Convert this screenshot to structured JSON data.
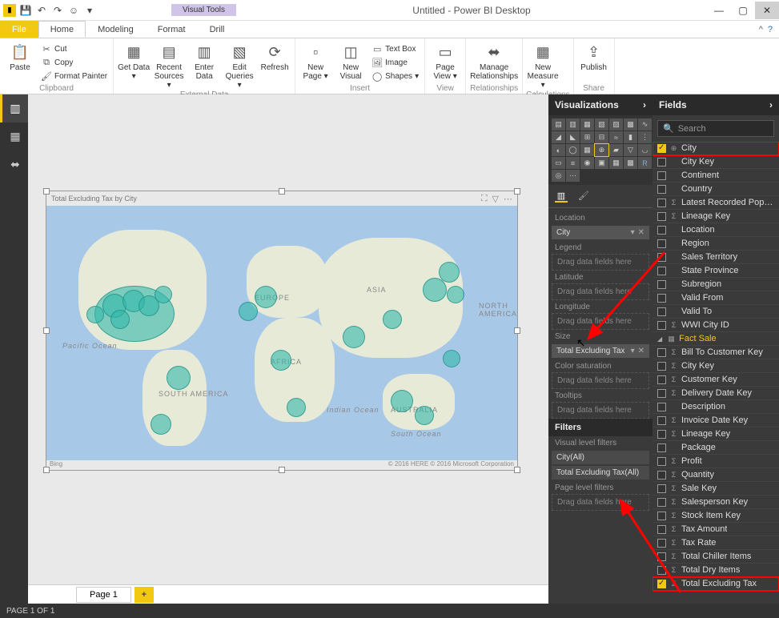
{
  "window": {
    "title": "Untitled - Power BI Desktop",
    "visual_tools": "Visual Tools"
  },
  "qat": {
    "save": "💾",
    "undo": "↶",
    "redo": "↷",
    "smile": "☺"
  },
  "tabs": {
    "file": "File",
    "home": "Home",
    "modeling": "Modeling",
    "format": "Format",
    "drill": "Drill"
  },
  "ribbon": {
    "clipboard": {
      "label": "Clipboard",
      "paste": "Paste",
      "cut": "Cut",
      "copy": "Copy",
      "format_painter": "Format Painter"
    },
    "external": {
      "label": "External Data",
      "get_data": "Get Data",
      "recent": "Recent Sources",
      "enter": "Enter Data",
      "edit": "Edit Queries",
      "refresh": "Refresh"
    },
    "insert": {
      "label": "Insert",
      "new_page": "New Page",
      "new_visual": "New Visual",
      "text_box": "Text Box",
      "image": "Image",
      "shapes": "Shapes"
    },
    "view": {
      "label": "View",
      "page_view": "Page View"
    },
    "relationships": {
      "label": "Relationships",
      "manage": "Manage Relationships"
    },
    "calc": {
      "label": "Calculations",
      "new_measure": "New Measure"
    },
    "share": {
      "label": "Share",
      "publish": "Publish"
    }
  },
  "visual": {
    "title": "Total Excluding Tax by City",
    "bing": "Bing",
    "copyright": "© 2016 HERE © 2016 Microsoft Corporation"
  },
  "map_labels": {
    "na": "NORTH AMERICA",
    "sa": "SOUTH AMERICA",
    "eu": "EUROPE",
    "af": "AFRICA",
    "as": "ASIA",
    "au": "AUSTRALIA",
    "po": "Pacific Ocean",
    "so": "South Ocean",
    "io": "Indian Ocean"
  },
  "pages": {
    "page1": "Page 1",
    "status": "PAGE 1 OF 1"
  },
  "viz_pane": {
    "title": "Visualizations",
    "wells": {
      "location": "Location",
      "location_val": "City",
      "legend": "Legend",
      "latitude": "Latitude",
      "longitude": "Longitude",
      "size": "Size",
      "size_val": "Total Excluding Tax",
      "color_sat": "Color saturation",
      "tooltips": "Tooltips",
      "drag": "Drag data fields here"
    },
    "filters": {
      "title": "Filters",
      "visual_level": "Visual level filters",
      "city": "City(All)",
      "tet": "Total Excluding Tax(All)",
      "page_level": "Page level filters"
    }
  },
  "fields_pane": {
    "title": "Fields",
    "search": "Search",
    "dim_city": [
      {
        "name": "City",
        "checked": true,
        "icon": "⊕",
        "hl": true
      },
      {
        "name": "City Key",
        "checked": false,
        "icon": ""
      },
      {
        "name": "Continent",
        "checked": false,
        "icon": ""
      },
      {
        "name": "Country",
        "checked": false,
        "icon": ""
      },
      {
        "name": "Latest Recorded Popu…",
        "checked": false,
        "icon": "Σ"
      },
      {
        "name": "Lineage Key",
        "checked": false,
        "icon": "Σ"
      },
      {
        "name": "Location",
        "checked": false,
        "icon": ""
      },
      {
        "name": "Region",
        "checked": false,
        "icon": ""
      },
      {
        "name": "Sales Territory",
        "checked": false,
        "icon": ""
      },
      {
        "name": "State Province",
        "checked": false,
        "icon": ""
      },
      {
        "name": "Subregion",
        "checked": false,
        "icon": ""
      },
      {
        "name": "Valid From",
        "checked": false,
        "icon": ""
      },
      {
        "name": "Valid To",
        "checked": false,
        "icon": ""
      },
      {
        "name": "WWI City ID",
        "checked": false,
        "icon": "Σ"
      }
    ],
    "fact_sale_label": "Fact Sale",
    "fact_sale": [
      {
        "name": "Bill To Customer Key",
        "checked": false,
        "icon": "Σ"
      },
      {
        "name": "City Key",
        "checked": false,
        "icon": "Σ"
      },
      {
        "name": "Customer Key",
        "checked": false,
        "icon": "Σ"
      },
      {
        "name": "Delivery Date Key",
        "checked": false,
        "icon": "Σ"
      },
      {
        "name": "Description",
        "checked": false,
        "icon": ""
      },
      {
        "name": "Invoice Date Key",
        "checked": false,
        "icon": "Σ"
      },
      {
        "name": "Lineage Key",
        "checked": false,
        "icon": "Σ"
      },
      {
        "name": "Package",
        "checked": false,
        "icon": ""
      },
      {
        "name": "Profit",
        "checked": false,
        "icon": "Σ"
      },
      {
        "name": "Quantity",
        "checked": false,
        "icon": "Σ"
      },
      {
        "name": "Sale Key",
        "checked": false,
        "icon": "Σ"
      },
      {
        "name": "Salesperson Key",
        "checked": false,
        "icon": "Σ"
      },
      {
        "name": "Stock Item Key",
        "checked": false,
        "icon": "Σ"
      },
      {
        "name": "Tax Amount",
        "checked": false,
        "icon": "Σ"
      },
      {
        "name": "Tax Rate",
        "checked": false,
        "icon": "Σ"
      },
      {
        "name": "Total Chiller Items",
        "checked": false,
        "icon": "Σ"
      },
      {
        "name": "Total Dry Items",
        "checked": false,
        "icon": "Σ"
      },
      {
        "name": "Total Excluding Tax",
        "checked": true,
        "icon": "Σ",
        "hl": true
      }
    ]
  }
}
